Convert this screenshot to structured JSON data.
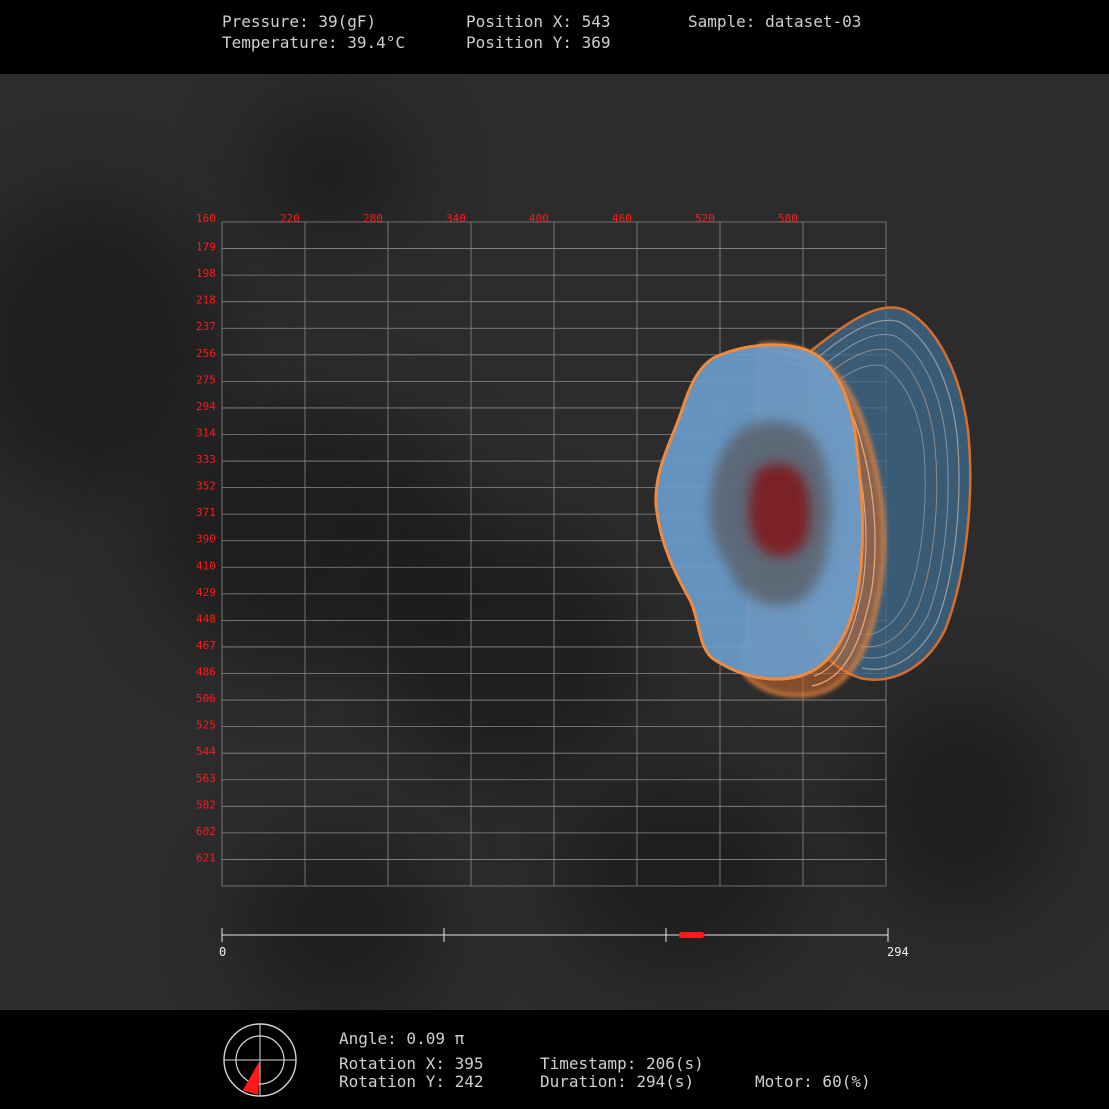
{
  "header": {
    "pressure": "Pressure: 39(gF)",
    "temperature": "Temperature: 39.4°C",
    "position_x": "Position X: 543",
    "position_y": "Position Y: 369",
    "sample": "Sample: dataset-03"
  },
  "grid": {
    "x_ticks": [
      "160",
      "220",
      "280",
      "340",
      "400",
      "460",
      "520",
      "580"
    ],
    "y_ticks": [
      "179",
      "198",
      "218",
      "237",
      "256",
      "275",
      "294",
      "314",
      "333",
      "352",
      "371",
      "390",
      "410",
      "429",
      "448",
      "467",
      "486",
      "506",
      "525",
      "544",
      "563",
      "582",
      "602",
      "621"
    ],
    "label_color": "#ff1a1a",
    "line_color": "#8a8a8a"
  },
  "specimen": {
    "outer_color": "#e8772e",
    "body_color": "#6a9ccc",
    "core_color": "#7a2228"
  },
  "timeline": {
    "start_label": "0",
    "end_label": "294",
    "max": 294,
    "current": 206,
    "marker_color": "#ff1a1a"
  },
  "footer": {
    "angle": "Angle: 0.09 π",
    "rotation_x": "Rotation X: 395",
    "rotation_y": "Rotation Y: 242",
    "timestamp": "Timestamp: 206(s)",
    "duration": "Duration: 294(s)",
    "motor": "Motor: 60(%)",
    "compass_icon": "compass-icon",
    "angle_value_pi": 0.09
  }
}
